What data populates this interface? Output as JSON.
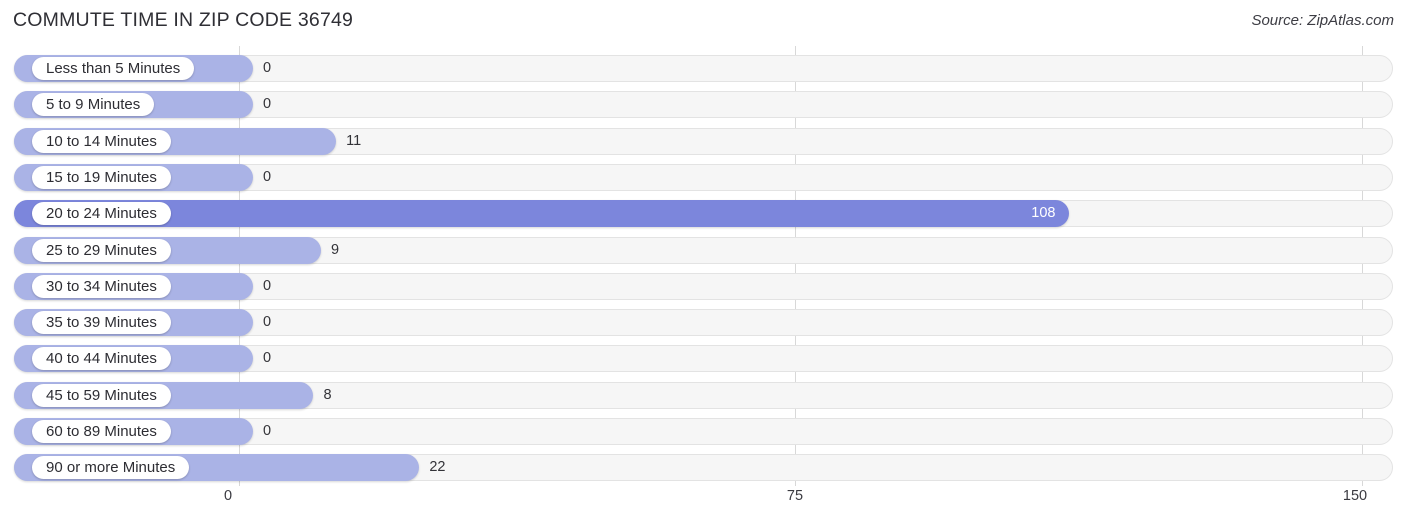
{
  "header": {
    "title": "COMMUTE TIME IN ZIP CODE 36749",
    "source": "Source: ZipAtlas.com"
  },
  "colors": {
    "bar": "#aab3e6",
    "bar_highlight": "#7c86dc",
    "track": "#f6f6f6",
    "gridline": "#d8d8d8",
    "text": "#2d2d33",
    "value_inside": "#ffffff"
  },
  "chart_data": {
    "type": "bar",
    "orientation": "horizontal",
    "title": "COMMUTE TIME IN ZIP CODE 36749",
    "subtitle": "",
    "xlabel": "",
    "ylabel": "",
    "xlim": [
      0,
      150
    ],
    "ticks": [
      0,
      75,
      150
    ],
    "tick_labels": [
      "0",
      "75",
      "150"
    ],
    "grid": true,
    "legend": "none",
    "categories": [
      "Less than 5 Minutes",
      "5 to 9 Minutes",
      "10 to 14 Minutes",
      "15 to 19 Minutes",
      "20 to 24 Minutes",
      "25 to 29 Minutes",
      "30 to 34 Minutes",
      "35 to 39 Minutes",
      "40 to 44 Minutes",
      "45 to 59 Minutes",
      "60 to 89 Minutes",
      "90 or more Minutes"
    ],
    "values": [
      0,
      0,
      11,
      0,
      108,
      9,
      0,
      0,
      0,
      8,
      0,
      22
    ],
    "value_labels": [
      "0",
      "0",
      "11",
      "0",
      "108",
      "9",
      "0",
      "0",
      "0",
      "8",
      "0",
      "22"
    ],
    "highlight_index": 4
  }
}
